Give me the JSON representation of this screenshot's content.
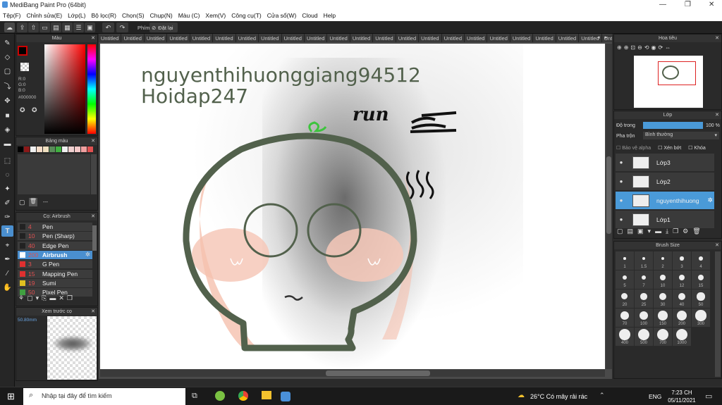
{
  "window": {
    "title": "MediBang Paint Pro (64bit)",
    "controls": [
      "—",
      "❐",
      "✕"
    ]
  },
  "menu": [
    "Tệp(F)",
    "Chỉnh sửa(E)",
    "Lớp(L)",
    "Bộ lọc(R)",
    "Chọn(S)",
    "Chụp(N)",
    "Màu (C)",
    "Xem(V)",
    "Công cụ(T)",
    "Cửa sổ(W)",
    "Cloud",
    "Help"
  ],
  "toolbar": {
    "key_label": "Phím",
    "reset_label": "Đặt lại"
  },
  "color_panel": {
    "title": "Màu",
    "r": "R:0",
    "g": "G:0",
    "b": "B:0",
    "hex": "#000000"
  },
  "palette_panel": {
    "title": "Bảng màu",
    "dash": "---",
    "swatches": [
      "#000000",
      "#8a1818",
      "#f0f0f0",
      "#f5dcc8",
      "#f0e0c0",
      "#5a8c5a",
      "#40b040",
      "#f0f0f0",
      "#f0d0d0",
      "#f5c8c8",
      "#f0a0a0",
      "#e05050"
    ]
  },
  "brush_panel": {
    "title": "Cọ: Airbrush",
    "items": [
      {
        "size": "4",
        "name": "Pen",
        "color": "#222222"
      },
      {
        "size": "10",
        "name": "Pen (Sharp)",
        "color": "#222222"
      },
      {
        "size": "40",
        "name": "Edge Pen",
        "color": "#222222"
      },
      {
        "size": "200",
        "name": "Airbrush",
        "color": "#ffffff",
        "selected": true
      },
      {
        "size": "3",
        "name": "G Pen",
        "color": "#e03030"
      },
      {
        "size": "15",
        "name": "Mapping Pen",
        "color": "#e03030"
      },
      {
        "size": "19",
        "name": "Sumi",
        "color": "#e0c020"
      },
      {
        "size": "50",
        "name": "Pixel Pen",
        "color": "#40a040"
      }
    ]
  },
  "preview_panel": {
    "title": "Xem trước cọ",
    "size": "50.80mm"
  },
  "tabs": [
    "Untitled",
    "Untitled",
    "Untitled",
    "Untitled",
    "Untitled",
    "Untitled",
    "Untitled",
    "Untitled",
    "Untitled",
    "Untitled",
    "Untitled",
    "Untitled",
    "Untitled",
    "Untitled",
    "Untitled",
    "Untitled",
    "Untitled",
    "Untitled",
    "Untitled",
    "Untitled",
    "Untitled",
    "Untitled",
    "Untitled",
    "Untitled"
  ],
  "canvas": {
    "line1": "nguyenthihuonggiang94512",
    "line2": "Hoidap247",
    "scribble": "run",
    "accent": "#52614c"
  },
  "nav_panel": {
    "title": "Hoa tiêu"
  },
  "layer_panel": {
    "title": "Lớp",
    "opacity_label": "Độ trong",
    "opacity_value": "100 %",
    "opacity_fraction": 1.0,
    "blend_label": "Pha trộn",
    "blend_value": "Bình thường",
    "alpha_label": "Bảo vệ alpha",
    "clip_label": "Xén bớt",
    "lock_label": "Khóa",
    "layers": [
      {
        "name": "Lớp3",
        "selected": false
      },
      {
        "name": "Lớp2",
        "selected": false
      },
      {
        "name": "nguyenthihuong",
        "selected": true
      },
      {
        "name": "Lớp1",
        "selected": false
      }
    ]
  },
  "brush_size_panel": {
    "title": "Brush Size",
    "sizes": [
      "1",
      "1.5",
      "2",
      "3",
      "4",
      "5",
      "7",
      "10",
      "12",
      "15",
      "20",
      "25",
      "30",
      "40",
      "50",
      "70",
      "100",
      "150",
      "200",
      "300",
      "400",
      "500",
      "700",
      "1000"
    ]
  },
  "taskbar": {
    "search_placeholder": "Nhập tại đây để tìm kiếm",
    "weather": "26°C  Có mây rải rác",
    "lang": "ENG",
    "time": "7:23 CH",
    "date": "05/11/2021"
  }
}
